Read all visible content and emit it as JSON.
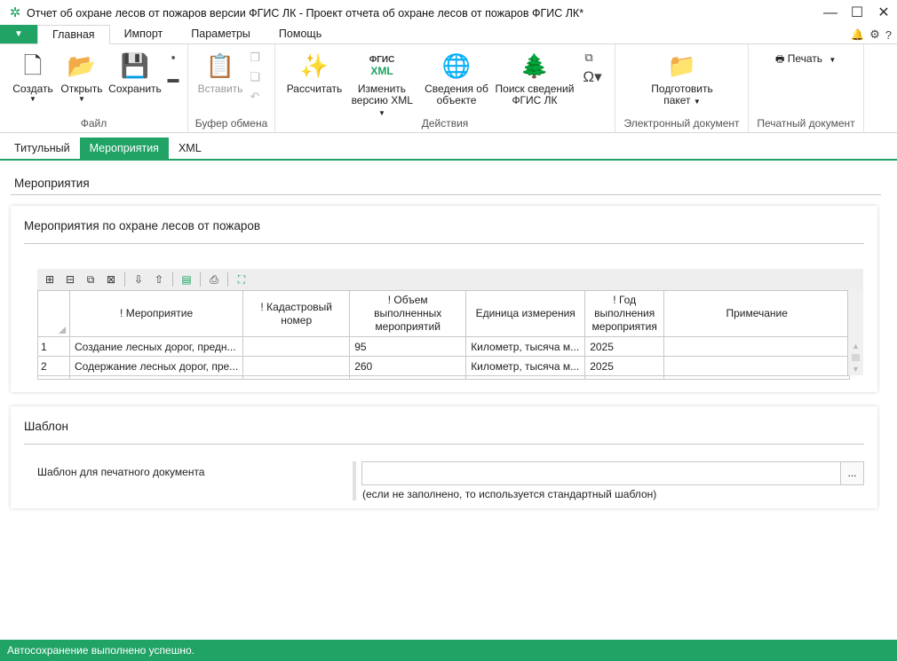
{
  "window": {
    "title": "Отчет об охране лесов от пожаров версии ФГИС ЛК - Проект отчета об охране лесов от пожаров ФГИС ЛК*",
    "minimize": "—",
    "maximize": "☐",
    "close": "✕"
  },
  "ribbon_tabs": {
    "file": "▼",
    "items": [
      "Главная",
      "Импорт",
      "Параметры",
      "Помощь"
    ]
  },
  "ribbon_right": {
    "bell": "🔔",
    "gear": "⚙",
    "help": "?"
  },
  "ribbon": {
    "file_group": {
      "label": "Файл",
      "create": "Создать",
      "open": "Открыть",
      "save": "Сохранить"
    },
    "clipboard_group": {
      "label": "Буфер обмена",
      "paste": "Вставить"
    },
    "actions_group": {
      "label": "Действия",
      "calculate": "Рассчитать",
      "change_xml_line1": "Изменить",
      "change_xml_line2": "версию XML",
      "fgis_xml_top": "ФГИС",
      "fgis_xml_bottom": "XML",
      "object_info_line1": "Сведения об",
      "object_info_line2": "объекте",
      "search_line1": "Поиск сведений",
      "search_line2": "ФГИС ЛК"
    },
    "edoc_group": {
      "label": "Электронный документ",
      "prepare_line1": "Подготовить",
      "prepare_line2": "пакет"
    },
    "print_group": {
      "label": "Печатный документ",
      "print": "Печать"
    }
  },
  "doc_tabs": [
    "Титульный",
    "Мероприятия",
    "XML"
  ],
  "section_title": "Мероприятия",
  "events_panel": {
    "title": "Мероприятия по охране лесов от пожаров",
    "columns": [
      "! Мероприятие",
      "! Кадастровый номер",
      "! Объем выполненных мероприятий",
      "Единица измерения",
      "! Год выполнения мероприятия",
      "Примечание"
    ],
    "rows": [
      {
        "num": "1",
        "event": "Создание лесных дорог, предн...",
        "cadastral": "",
        "volume": "95",
        "unit": "Километр, тысяча м...",
        "year": "2025",
        "note": ""
      },
      {
        "num": "2",
        "event": "Содержание лесных дорог, пре...",
        "cadastral": "",
        "volume": "260",
        "unit": "Километр, тысяча м...",
        "year": "2025",
        "note": ""
      }
    ]
  },
  "template_panel": {
    "title": "Шаблон",
    "field_label": "Шаблон для печатного документа",
    "field_value": "",
    "browse": "...",
    "hint": "(если не заполнено, то используется стандартный шаблон)"
  },
  "status": "Автосохранение выполнено успешно.",
  "colors": {
    "accent": "#21a366"
  }
}
